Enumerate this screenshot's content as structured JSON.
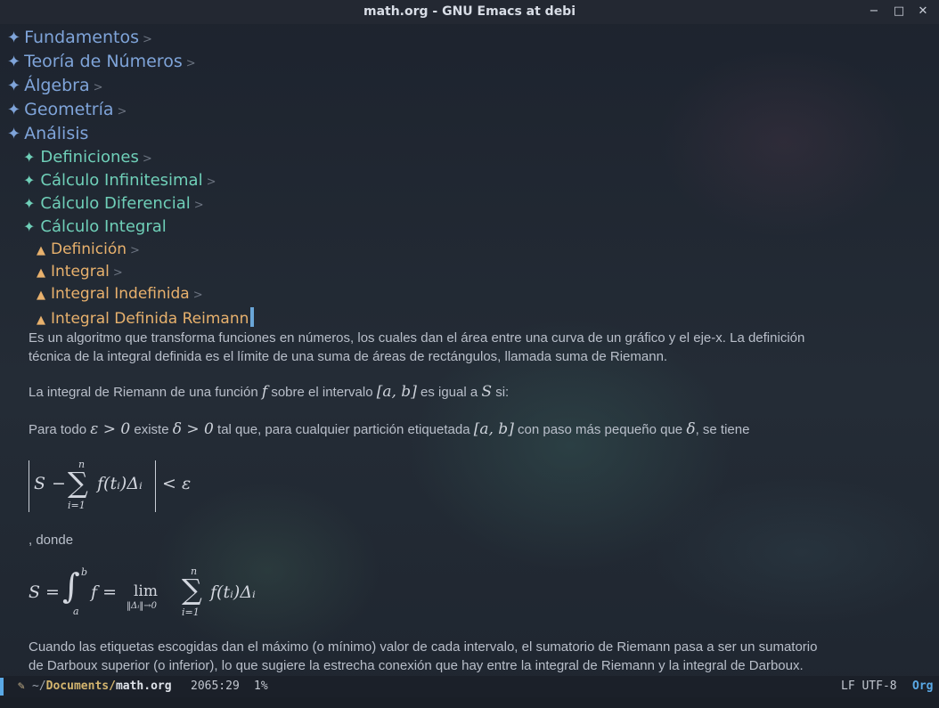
{
  "window": {
    "title": "math.org - GNU Emacs at debi",
    "minimize": "−",
    "maximize": "□",
    "close": "✕"
  },
  "outline": {
    "star_l1": "✦",
    "star_l2": "✦",
    "star_l3": "▲",
    "fold": ">",
    "level1": [
      "Fundamentos",
      "Teoría de Números",
      "Álgebra",
      "Geometría",
      "Análisis"
    ],
    "level2": [
      "Definiciones",
      "Cálculo Infinitesimal",
      "Cálculo Diferencial",
      "Cálculo Integral"
    ],
    "level3": [
      "Definición",
      "Integral",
      "Integral Indefinida",
      "Integral Definida Reimann"
    ]
  },
  "content": {
    "p1_line1": "Es un algoritmo que transforma funciones en números, los cuales dan el área entre una curva de un gráfico y el eje-x. La definición",
    "p1_line2": "técnica de la integral definida es el límite de una suma de áreas de rectángulos, llamada suma de Riemann.",
    "p2_a": "La integral de Riemann de una función ",
    "p2_f": "f",
    "p2_b": " sobre el intervalo ",
    "p2_int": "[a, b]",
    "p2_c": " es igual a ",
    "p2_S": "S",
    "p2_d": " si:",
    "p3_a": "Para todo ",
    "p3_eps": "ε > 0",
    "p3_b": " existe ",
    "p3_delta": "δ > 0",
    "p3_c": " tal que, para cualquier partición etiquetada ",
    "p3_int": "[a, b]",
    "p3_d": " con paso más pequeño que ",
    "p3_delta2": "δ",
    "p3_e": ", se tiene",
    "donde": ", donde",
    "p4_line1": "Cuando las etiquetas escogidas dan el máximo (o mínimo) valor de cada intervalo, el sumatorio de Riemann pasa a ser un sumatorio",
    "p4_line2": "de Darboux superior (o inferior), lo que sugiere la estrecha conexión que hay entre la integral de Riemann y la integral de Darboux."
  },
  "equations": {
    "eq1": {
      "S": "S",
      "minus": "−",
      "sum": "∑",
      "sum_top": "n",
      "sum_bottom": "i=1",
      "term": "f(tᵢ)Δᵢ",
      "rhs": "< ε"
    },
    "eq2": {
      "lhs": "S =",
      "integral": "∫",
      "int_top": "b",
      "int_bottom": "a",
      "f_eq": "f =",
      "lim": "lim",
      "lim_sub": "‖Δᵢ‖→0",
      "sum": "∑",
      "sum_top": "n",
      "sum_bottom": "i=1",
      "term": "f(tᵢ)Δᵢ"
    }
  },
  "modeline": {
    "icon": "✎",
    "path_prefix": "~/",
    "dir": "Documents/",
    "file": "math.org",
    "position": "2065:29",
    "percent": "1%",
    "eol_encoding": "LF UTF-8",
    "mode": "Org"
  },
  "colors": {
    "level1": "#7fa4d9",
    "level2": "#6fcfb8",
    "level3": "#e8b16d",
    "accent": "#5aa9e6"
  }
}
